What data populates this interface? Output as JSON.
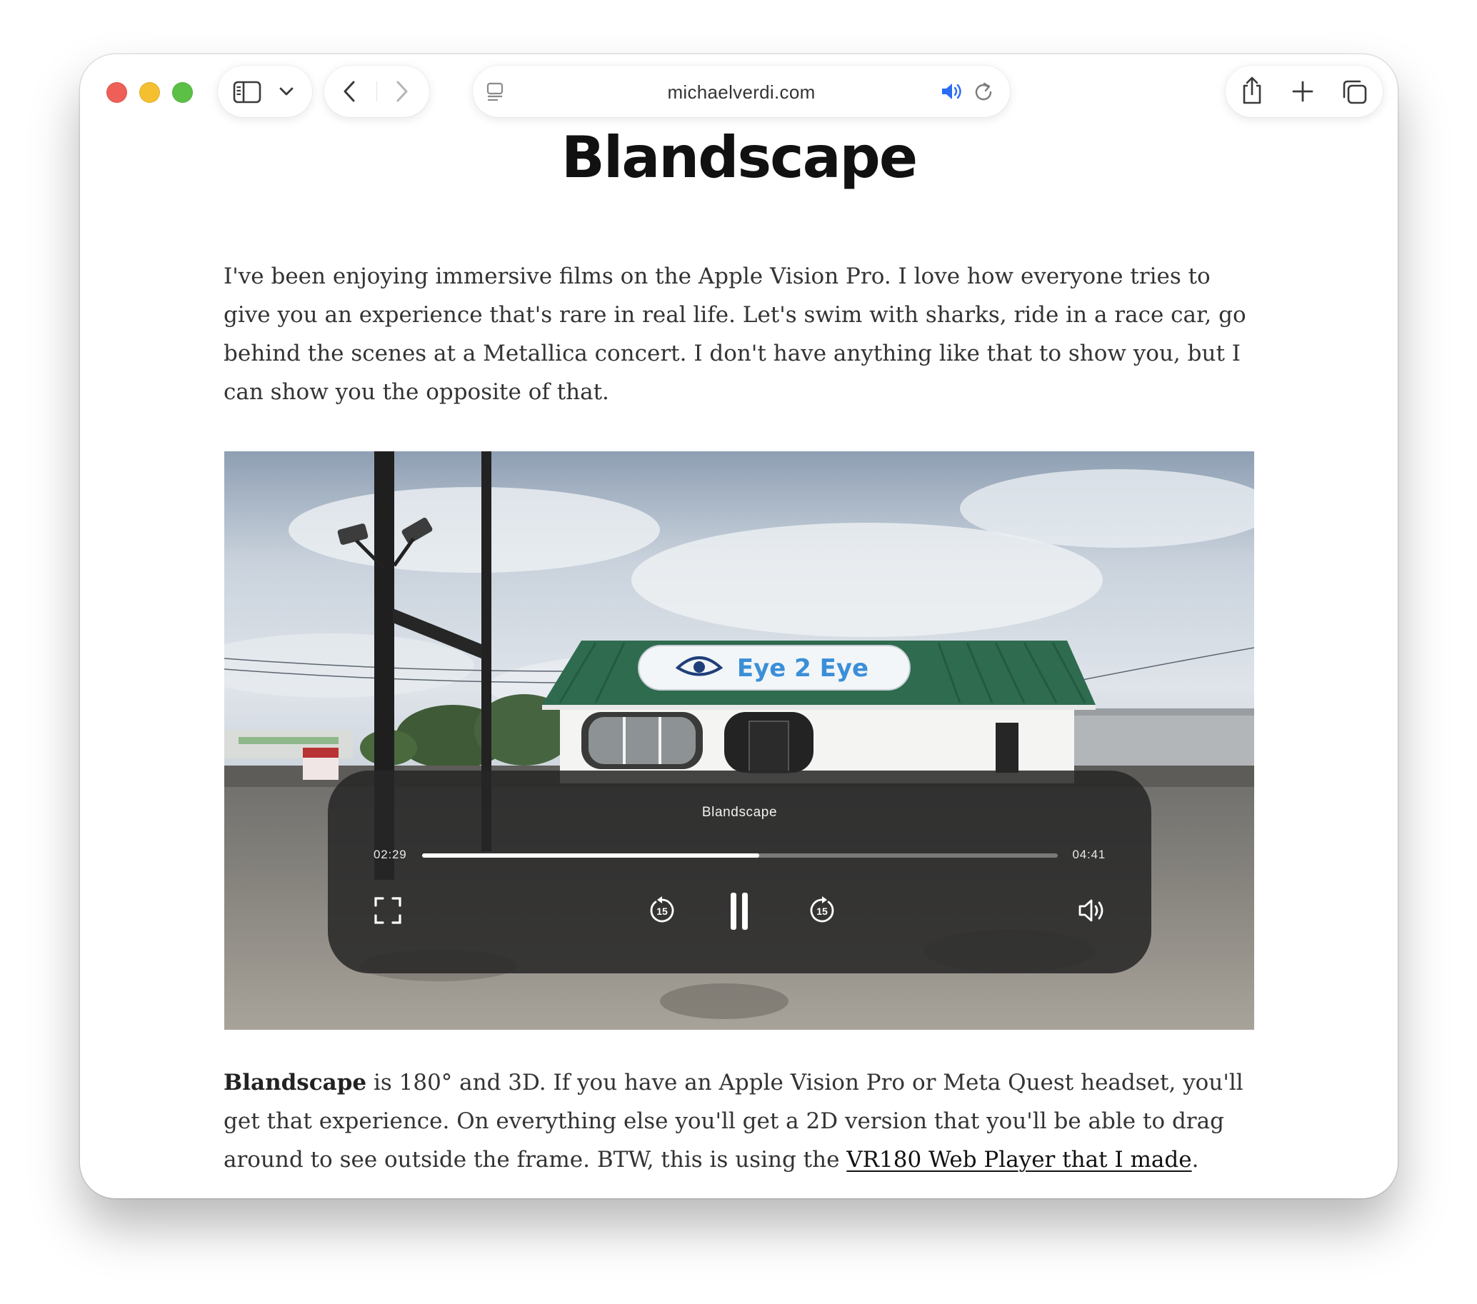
{
  "browser": {
    "url": "michaelverdi.com",
    "colors": {
      "close": "#ed5f57",
      "minimize": "#f4c02f",
      "zoom": "#5cc046",
      "audio_accent": "#2a6df4"
    }
  },
  "article": {
    "title": "Blandscape",
    "intro": "I've been enjoying immersive films on the Apple Vision Pro. I love how everyone tries to give you an experience that's rare in real life. Let's swim with sharks, ride in a race car, go behind the scenes at a Metallica concert. I don't have anything like that to show you, but I can show you the opposite of that.",
    "body_bold": "Blandscape",
    "body_text": " is 180° and 3D. If you have an Apple Vision Pro or Meta Quest headset, you'll get that experience. On everything else you'll get a 2D version that you'll be able to drag around to see outside the frame. BTW, this is using the ",
    "body_link": "VR180 Web Player that I made",
    "body_end": "."
  },
  "video": {
    "sign_text": "Eye 2 Eye",
    "title": "Blandscape",
    "current_time": "02:29",
    "duration": "04:41",
    "progress": 0.53,
    "skip_seconds": "15"
  },
  "icons": {
    "toolbar": [
      "sidebar-icon",
      "chevron-down-icon",
      "back-icon",
      "forward-icon",
      "reader-icon",
      "audio-playing-icon",
      "reload-icon",
      "share-icon",
      "new-tab-icon",
      "tab-overview-icon"
    ],
    "player": [
      "fullscreen-icon",
      "skip-back-15-icon",
      "pause-icon",
      "skip-forward-15-icon",
      "volume-icon"
    ]
  }
}
